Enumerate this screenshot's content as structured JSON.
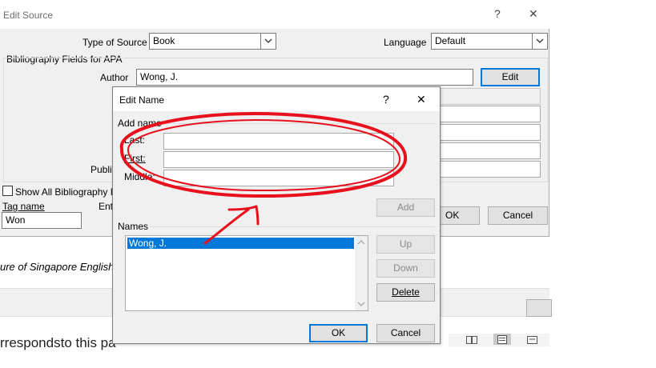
{
  "background_document": {
    "italic_text": "ure of Singapore English",
    "body_text": "rrespondsto this pa"
  },
  "edit_source": {
    "title": "Edit Source",
    "help_glyph": "?",
    "close_glyph": "✕",
    "type_of_source_label": "Type of Source",
    "type_of_source_value": "Book",
    "language_label": "Language",
    "language_value": "Default",
    "fields_group_label": "Bibliography Fields for APA",
    "author_label": "Author",
    "author_value": "Wong, J.",
    "edit_button": "Edit",
    "publisher_label": "Publi",
    "show_all_label": "Show All Bibliography F",
    "tag_name_label": "Tag name",
    "tag_name_value": "Won",
    "example_label": "Ent",
    "ok_button": "OK",
    "cancel_button": "Cancel"
  },
  "edit_name": {
    "title": "Edit Name",
    "help_glyph": "?",
    "close_glyph": "✕",
    "add_name_label": "Add name",
    "last_label": "Last:",
    "first_label": "First:",
    "middle_label": "Middle:",
    "last_value": "",
    "first_value": "",
    "middle_value": "",
    "add_button": "Add",
    "names_label": "Names",
    "names": [
      "Wong, J."
    ],
    "up_button": "Up",
    "down_button": "Down",
    "delete_button": "Delete",
    "ok_button": "OK",
    "cancel_button": "Cancel"
  },
  "colors": {
    "annotation_red": "#e8101c",
    "selection_blue": "#0078d7",
    "dialog_bg": "#f0f0f0"
  }
}
